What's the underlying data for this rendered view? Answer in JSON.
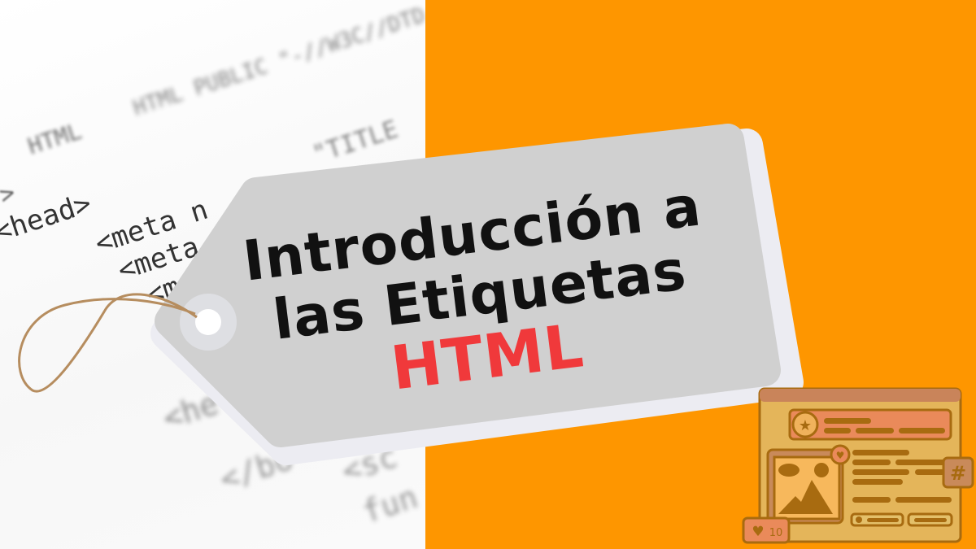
{
  "background_code": {
    "lines": [
      "HTML PUBLIC \"-//W3C//DTD",
      "HTML",
      "\"TITLE",
      ">",
      "<head>",
      "<meta n",
      "<meta",
      "<m",
      "<he",
      "</bo",
      "<sc",
      "fun"
    ]
  },
  "tag": {
    "line1": "Introducción a",
    "line2": "las Etiquetas",
    "line3": "HTML"
  },
  "illustration": {
    "likes_count": "10",
    "hash_symbol": "#"
  },
  "colors": {
    "orange": "#fe9600",
    "tag_gray": "#d0d0d0",
    "accent_red": "#f0393b"
  }
}
